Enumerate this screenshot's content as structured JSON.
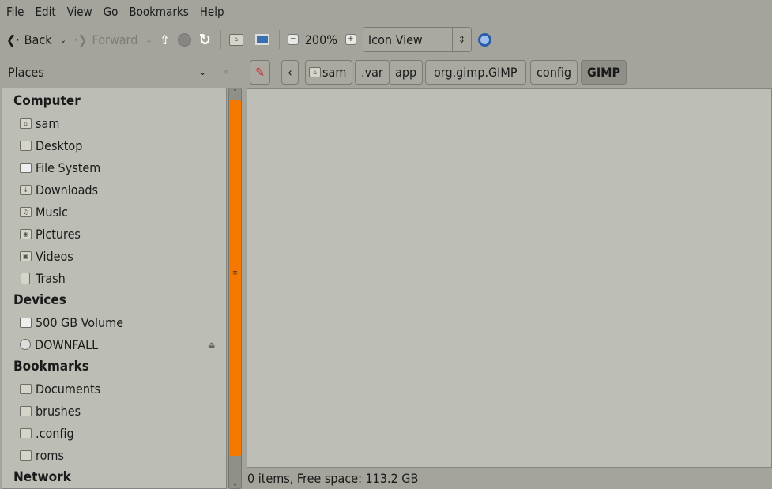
{
  "menu": [
    "File",
    "Edit",
    "View",
    "Go",
    "Bookmarks",
    "Help"
  ],
  "toolbar": {
    "back": "Back",
    "forward": "Forward",
    "zoom": "200%",
    "view": "Icon View"
  },
  "places": {
    "title": "Places"
  },
  "path": [
    "sam",
    ".var",
    "app",
    "org.gimp.GIMP",
    "config",
    "GIMP"
  ],
  "sidebar": {
    "computer": "Computer",
    "computer_items": [
      "sam",
      "Desktop",
      "File System",
      "Downloads",
      "Music",
      "Pictures",
      "Videos",
      "Trash"
    ],
    "devices": "Devices",
    "device_items": [
      "500 GB Volume",
      "DOWNFALL"
    ],
    "bookmarks": "Bookmarks",
    "bookmark_items": [
      "Documents",
      "brushes",
      ".config",
      "roms"
    ],
    "network": "Network"
  },
  "status": "0 items, Free space: 113.2 GB",
  "colors": {
    "scroll_thumb": "#f57900"
  }
}
